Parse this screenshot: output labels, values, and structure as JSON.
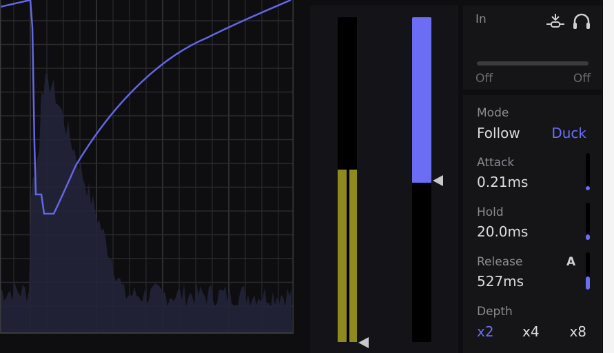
{
  "colors": {
    "accent": "#6b6ef5",
    "meter_yellow": "#8f8a1e"
  },
  "input": {
    "label": "In",
    "range_min_label": "Off",
    "range_max_label": "Off",
    "icons": [
      "sidechain-icon",
      "headphones-icon"
    ]
  },
  "meters": {
    "input_level": 0.53,
    "gain_reduction": 0.51
  },
  "mode": {
    "label": "Mode",
    "options": [
      "Follow",
      "Duck"
    ],
    "selected": "Duck"
  },
  "attack": {
    "label": "Attack",
    "value": "0.21ms",
    "fraction": 0.03
  },
  "hold": {
    "label": "Hold",
    "value": "20.0ms",
    "fraction": 0.15
  },
  "release": {
    "label": "Release",
    "value": "527ms",
    "fraction": 0.35,
    "auto_label": "A"
  },
  "depth": {
    "label": "Depth",
    "options": [
      "x2",
      "x4",
      "x8"
    ],
    "selected": "x2"
  }
}
